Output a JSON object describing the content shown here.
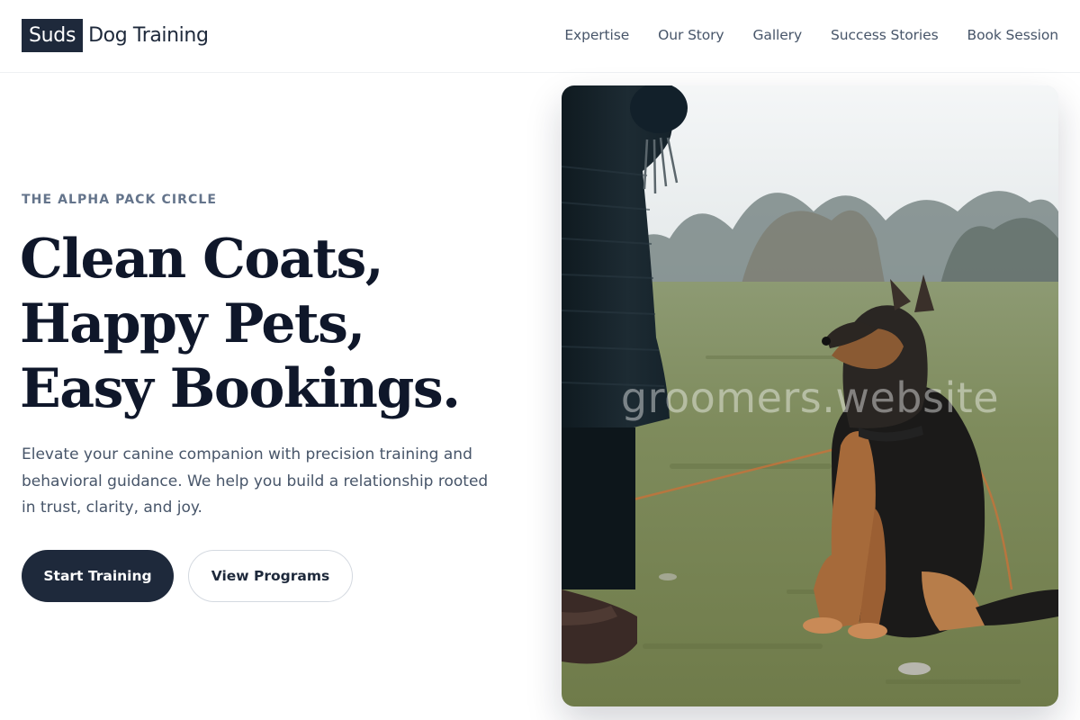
{
  "brand": {
    "badge": "Suds",
    "name": "Dog Training"
  },
  "nav": {
    "items": [
      {
        "label": "Expertise"
      },
      {
        "label": "Our Story"
      },
      {
        "label": "Gallery"
      },
      {
        "label": "Success Stories"
      },
      {
        "label": "Book Session"
      }
    ]
  },
  "hero": {
    "eyebrow": "THE ALPHA PACK CIRCLE",
    "headline": [
      "Clean Coats,",
      "Happy Pets,",
      "Easy Bookings."
    ],
    "lede": "Elevate your canine companion with precision training and behavioral guidance. We help you build a relationship rooted in trust, clarity, and joy.",
    "primary_cta": "Start Training",
    "secondary_cta": "View Programs",
    "image_watermark": "groomers.website"
  },
  "colors": {
    "primary": "#1e293b",
    "heading": "#0f172a",
    "muted": "#64748b",
    "body_text": "#475569",
    "border": "#d4d9e0"
  }
}
